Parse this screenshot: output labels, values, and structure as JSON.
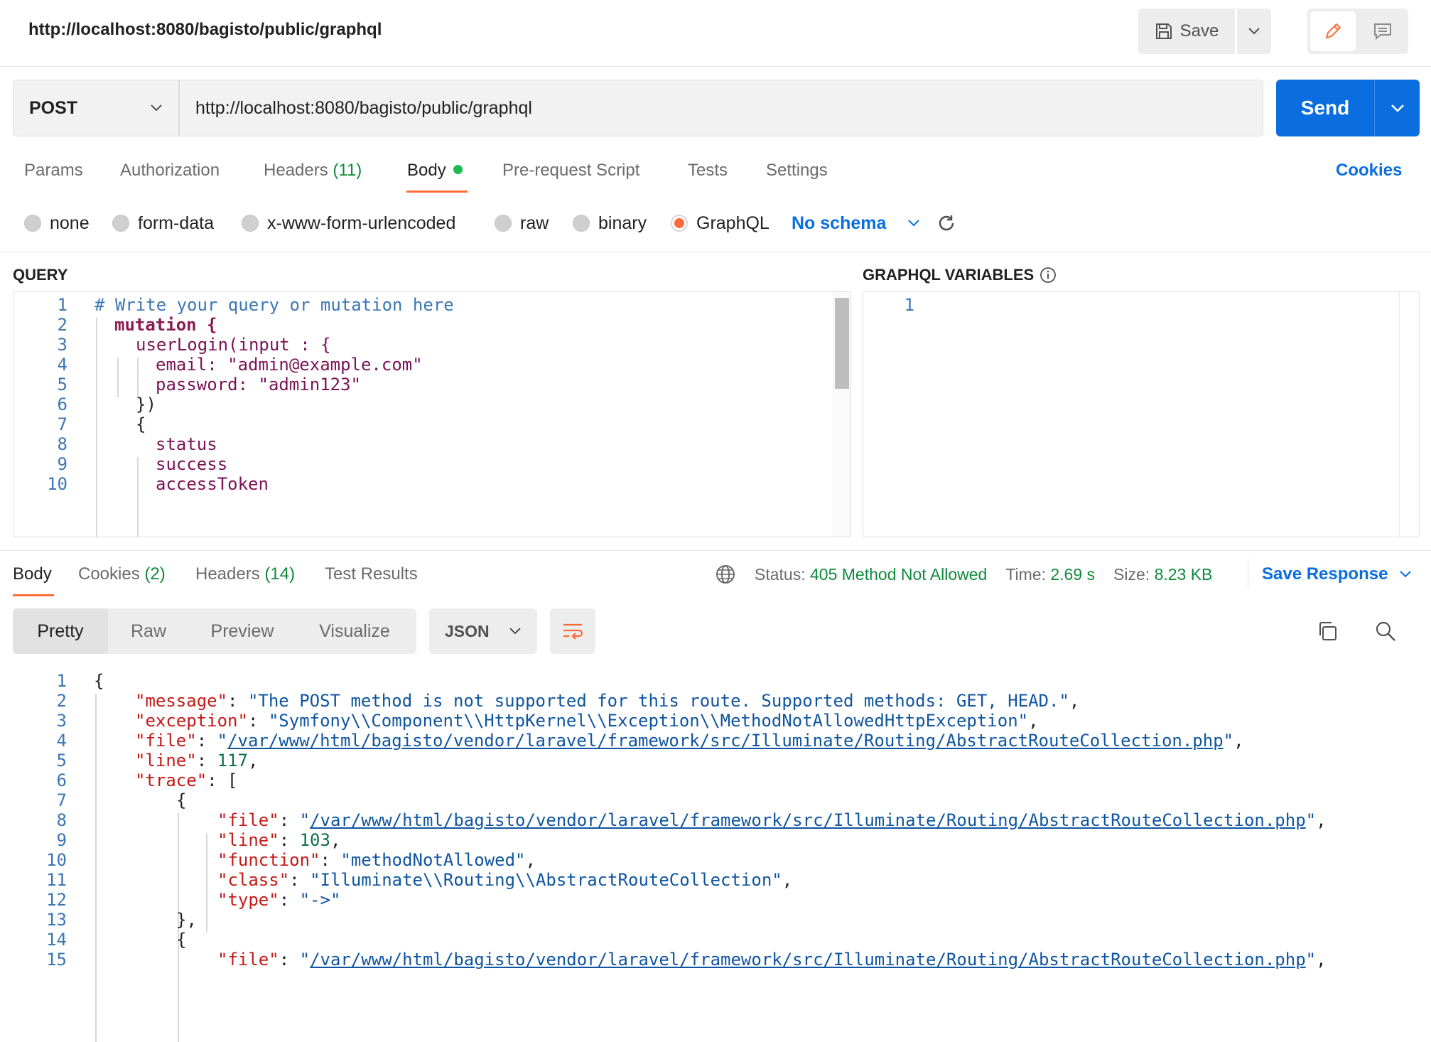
{
  "header": {
    "title": "http://localhost:8080/bagisto/public/graphql",
    "save_label": "Save"
  },
  "request": {
    "method": "POST",
    "url": "http://localhost:8080/bagisto/public/graphql",
    "send_label": "Send",
    "tabs": [
      {
        "label": "Params"
      },
      {
        "label": "Authorization"
      },
      {
        "label": "Headers",
        "count": "(11)"
      },
      {
        "label": "Body"
      },
      {
        "label": "Pre-request Script"
      },
      {
        "label": "Tests"
      },
      {
        "label": "Settings"
      }
    ],
    "active_tab": "Body",
    "cookies_label": "Cookies",
    "body_types": [
      "none",
      "form-data",
      "x-www-form-urlencoded",
      "raw",
      "binary",
      "GraphQL"
    ],
    "selected_body_type": "GraphQL",
    "schema_label": "No schema"
  },
  "query_editor": {
    "label": "QUERY",
    "lines": [
      "# Write your query or mutation here",
      "mutation {",
      "userLogin(input : {",
      "email: \"admin@example.com\"",
      "password: \"admin123\"",
      "})",
      "{",
      "status",
      "success",
      "accessToken"
    ],
    "line_numbers": [
      "1",
      "2",
      "3",
      "4",
      "5",
      "6",
      "7",
      "8",
      "9",
      "10"
    ]
  },
  "variables_editor": {
    "label": "GRAPHQL VARIABLES",
    "line_numbers": [
      "1"
    ]
  },
  "response": {
    "tabs": [
      {
        "label": "Body"
      },
      {
        "label": "Cookies",
        "count": "(2)"
      },
      {
        "label": "Headers",
        "count": "(14)"
      },
      {
        "label": "Test Results"
      }
    ],
    "status_label": "Status:",
    "status": "405 Method Not Allowed",
    "time_label": "Time:",
    "time": "2.69 s",
    "size_label": "Size:",
    "size": "8.23 KB",
    "save_response_label": "Save Response",
    "views": [
      "Pretty",
      "Raw",
      "Preview",
      "Visualize"
    ],
    "active_view": "Pretty",
    "format": "JSON",
    "body": {
      "line_numbers": [
        "1",
        "2",
        "3",
        "4",
        "5",
        "6",
        "7",
        "8",
        "9",
        "10",
        "11",
        "12",
        "13",
        "14",
        "15"
      ],
      "message_key": "\"message\"",
      "message": "\"The POST method is not supported for this route. Supported methods: GET, HEAD.\"",
      "exception_key": "\"exception\"",
      "exception": "\"Symfony\\\\Component\\\\HttpKernel\\\\Exception\\\\MethodNotAllowedHttpException\"",
      "file_key": "\"file\"",
      "file": "/var/www/html/bagisto/vendor/laravel/framework/src/Illuminate/Routing/AbstractRouteCollection.php",
      "line_key": "\"line\"",
      "line": "117",
      "trace_key": "\"trace\"",
      "trace0_file": "/var/www/html/bagisto/vendor/laravel/framework/src/Illuminate/Routing/AbstractRouteCollection.php",
      "trace0_line": "103",
      "function_key": "\"function\"",
      "trace0_function": "\"methodNotAllowed\"",
      "class_key": "\"class\"",
      "trace0_class": "\"Illuminate\\\\Routing\\\\AbstractRouteCollection\"",
      "type_key": "\"type\"",
      "trace0_type": "\"->\"",
      "trace1_file": "/var/www/html/bagisto/vendor/laravel/framework/src/Illuminate/Routing/AbstractRouteCollection.php"
    }
  },
  "colors": {
    "accent": "#ff6c37",
    "primary": "#0a6ee0",
    "success": "#0f8a3c"
  }
}
